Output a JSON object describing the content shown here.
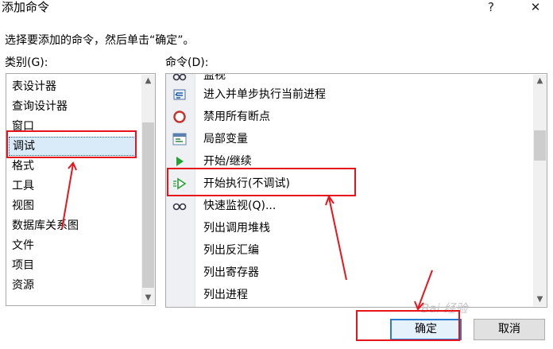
{
  "dialog": {
    "title": "添加命令",
    "help_label": "?",
    "close_label": "✕",
    "instruction": "选择要添加的命令，然后单击“确定”。"
  },
  "categories": {
    "label": "类别(G):",
    "selected": "调试",
    "items": [
      "表设计器",
      "查询设计器",
      "窗口",
      "调试",
      "格式",
      "工具",
      "视图",
      "数据库关系图",
      "文件",
      "项目",
      "资源"
    ]
  },
  "commands": {
    "label": "命令(D):",
    "partial_top_label": "监视",
    "items": [
      {
        "label": "进入并单步执行当前进程",
        "icon": "step-into-process-icon"
      },
      {
        "label": "禁用所有断点",
        "icon": "disable-breakpoints-icon"
      },
      {
        "label": "局部变量",
        "icon": "locals-window-icon"
      },
      {
        "label": "开始/继续",
        "icon": "start-continue-icon"
      },
      {
        "label": "开始执行(不调试)",
        "icon": "start-without-debugging-icon"
      },
      {
        "label": "快速监视(Q)...",
        "icon": "quick-watch-icon"
      },
      {
        "label": "列出调用堆栈",
        "icon": ""
      },
      {
        "label": "列出反汇编",
        "icon": ""
      },
      {
        "label": "列出寄存器",
        "icon": ""
      },
      {
        "label": "列出进程",
        "icon": ""
      }
    ]
  },
  "buttons": {
    "ok": "确定",
    "cancel": "取消"
  },
  "watermark": "Bai 经验",
  "colors": {
    "annotation_red": "#e8141c",
    "selection": "#d9ebf9",
    "ok_border": "#2a7bd3"
  }
}
